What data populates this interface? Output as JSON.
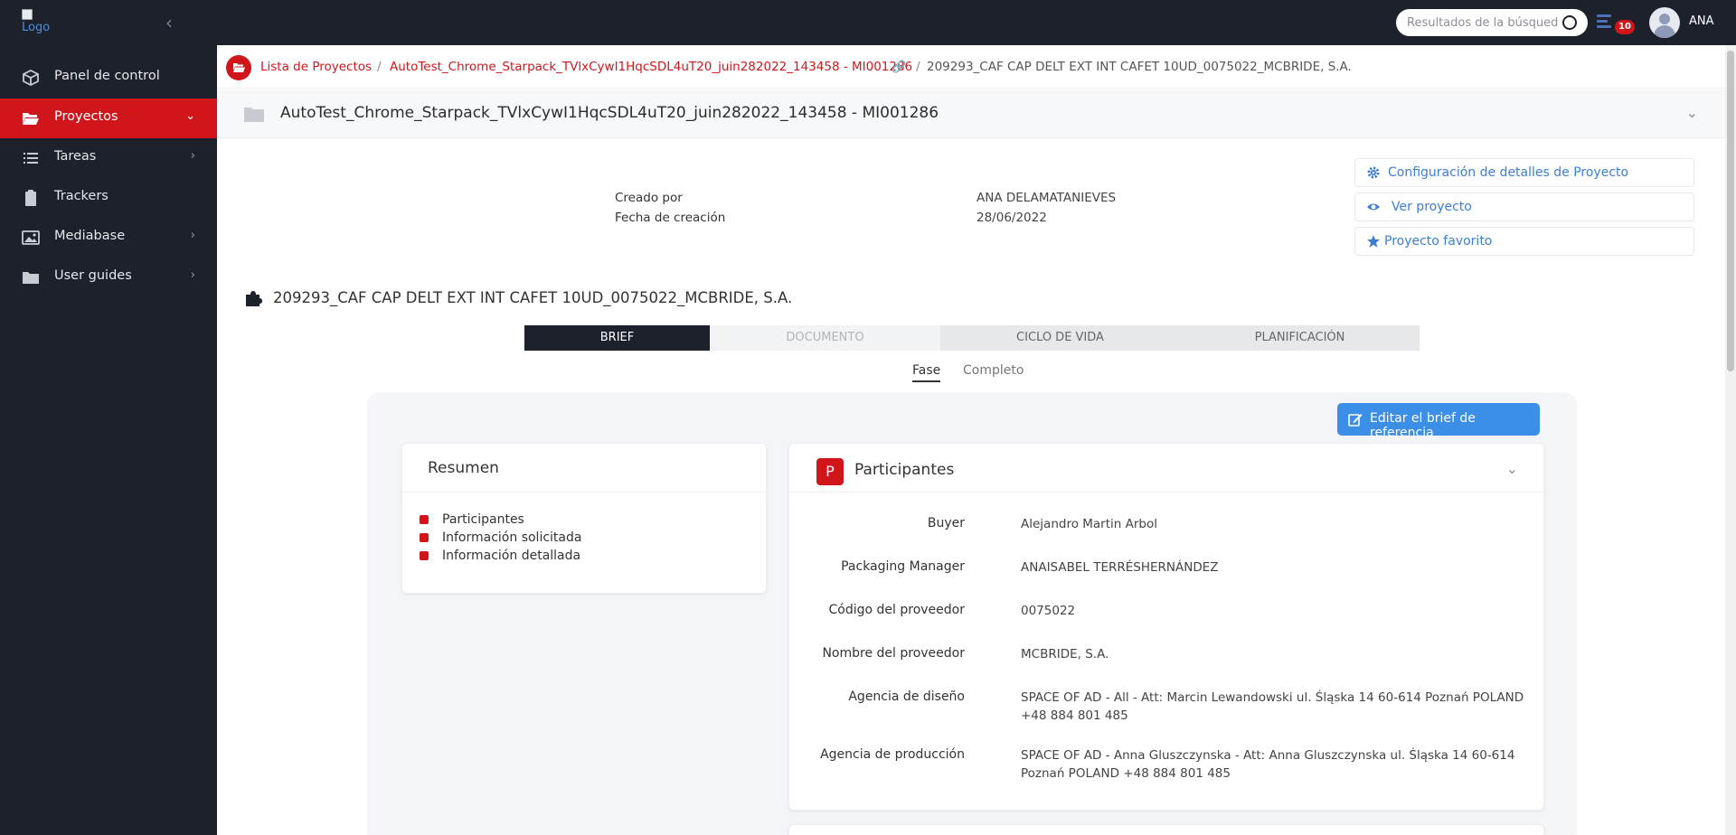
{
  "header": {
    "logo_alt": "Logo",
    "search_placeholder": "Resultados de la búsqueda",
    "tasks_badge": "10",
    "user": "ANA",
    "colors": {
      "brand": "#d0161b",
      "dark": "#1d212b",
      "accent": "#3b8fe6"
    }
  },
  "sidebar": {
    "items": [
      {
        "label": "Panel de control",
        "icon": "cube-icon"
      },
      {
        "label": "Proyectos",
        "icon": "folder-open-icon",
        "active": true
      },
      {
        "label": "Tareas",
        "icon": "list-icon"
      },
      {
        "label": "Trackers",
        "icon": "clipboard-icon"
      },
      {
        "label": "Mediabase",
        "icon": "image-icon"
      },
      {
        "label": "User guides",
        "icon": "folder-icon"
      }
    ]
  },
  "breadcrumb": {
    "item1": "Lista de Proyectos",
    "sep": "/",
    "item2": "AutoTest_Chrome_Starpack_TVlxCywI1HqcSDL4uT20_juin282022_143458 - MI001286",
    "item3": "209293_CAF CAP DELT EXT INT CAFET 10UD_0075022_MCBRIDE, S.A."
  },
  "project": {
    "title": "AutoTest_Chrome_Starpack_TVlxCywI1HqcSDL4uT20_juin282022_143458 - MI001286",
    "created_by_label": "Creado por",
    "created_by": "ANA DELAMATANIEVES",
    "created_date_label": "Fecha de creación",
    "created_date": "28/06/2022"
  },
  "actions": {
    "config": "Configuración de detalles de Proyecto",
    "view": "Ver proyecto",
    "favorite": "Proyecto favorito"
  },
  "section": {
    "title": "209293_CAF CAP DELT EXT INT CAFET 10UD_0075022_MCBRIDE, S.A."
  },
  "tabs": [
    "BRIEF",
    "DOCUMENTO",
    "CICLO DE VIDA",
    "PLANIFICACIÓN"
  ],
  "subtabs": [
    "Fase",
    "Completo"
  ],
  "edit_button": "Editar el brief de referencia",
  "summary": {
    "title": "Resumen",
    "items": [
      "Participantes",
      "Información solicitada",
      "Información detallada"
    ]
  },
  "participants": {
    "badge": "P",
    "title": "Participantes",
    "rows": [
      {
        "label": "Buyer",
        "value": "Alejandro Martin Arbol"
      },
      {
        "label": "Packaging Manager",
        "value": "ANAISABEL TERRÉSHERNÁNDEZ"
      },
      {
        "label": "Código del proveedor",
        "value": "0075022"
      },
      {
        "label": "Nombre del proveedor",
        "value": "MCBRIDE, S.A."
      },
      {
        "label": "Agencia de diseño",
        "value": "SPACE OF AD - All - Att: Marcin Lewandowski ul. Śląska 14 60-614 Poznań POLAND +48 884 801 485"
      },
      {
        "label": "Agencia de producción",
        "value": "SPACE OF AD - Anna Gluszczynska - Att: Anna Gluszczynska ul. Śląska 14 60-614 Poznań POLAND +48 884 801 485"
      }
    ]
  }
}
